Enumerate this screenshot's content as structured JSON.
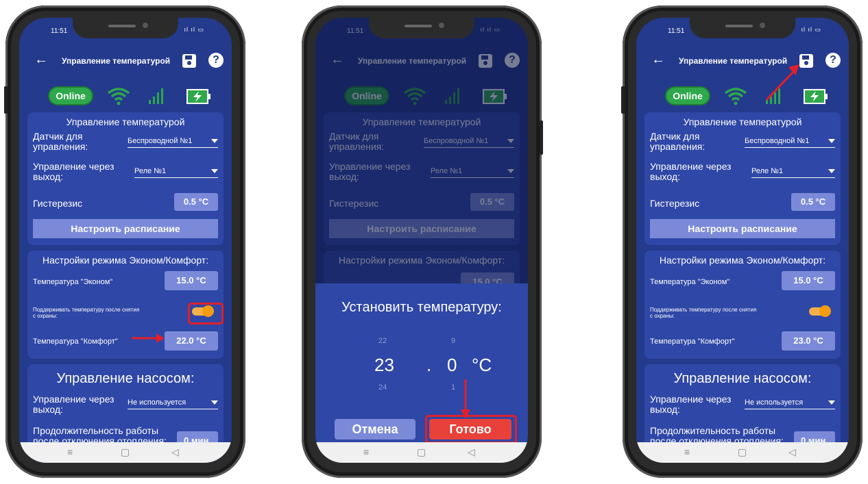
{
  "status": {
    "time": "11:51",
    "signal": " ıl ıl ▭"
  },
  "appbar": {
    "title": "Управление температурой",
    "help": "?"
  },
  "indicators": {
    "online": "Online"
  },
  "temp_card": {
    "heading": "Управление температурой",
    "sensor_label": "Датчик для управления:",
    "sensor_value": "Беспроводной №1",
    "output_label": "Управление через выход:",
    "output_value": "Реле №1",
    "hysteresis_label": "Гистерезис",
    "hysteresis_value": "0.5 °C",
    "schedule_button": "Настроить расписание"
  },
  "mode_card": {
    "heading": "Настройки режима Эконом/Комфорт:",
    "econom_label": "Температура \"Эконом\"",
    "econom_value": "15.0 °C",
    "keep_label": "Поддерживать температуру после снятия с охраны:",
    "keep_on": true,
    "comfort_label": "Температура \"Комфорт\"",
    "comfort_value_before": "22.0 °C",
    "comfort_value_after": "23.0 °C"
  },
  "pump_card": {
    "heading": "Управление насосом:",
    "output_label": "Управление через выход:",
    "output_value": "Не используется",
    "duration_label": "Продолжительность работы после отключения отопления:",
    "duration_value": "0 мин."
  },
  "dialog": {
    "title": "Установить температуру:",
    "int_prev": "22",
    "int_current": "23",
    "int_next": "24",
    "dot": ".",
    "frac_prev": "9",
    "frac_current": "0",
    "frac_next": "1",
    "unit": "°C",
    "cancel": "Отмена",
    "done": "Готово"
  },
  "navbar": {
    "menu": "≡",
    "home": "▢",
    "back": "◁"
  },
  "colors": {
    "accent_red": "#e0202a",
    "online_green": "#2ea84a",
    "toggle_orange": "#f39c12",
    "screen_bg": "#243a8c"
  }
}
